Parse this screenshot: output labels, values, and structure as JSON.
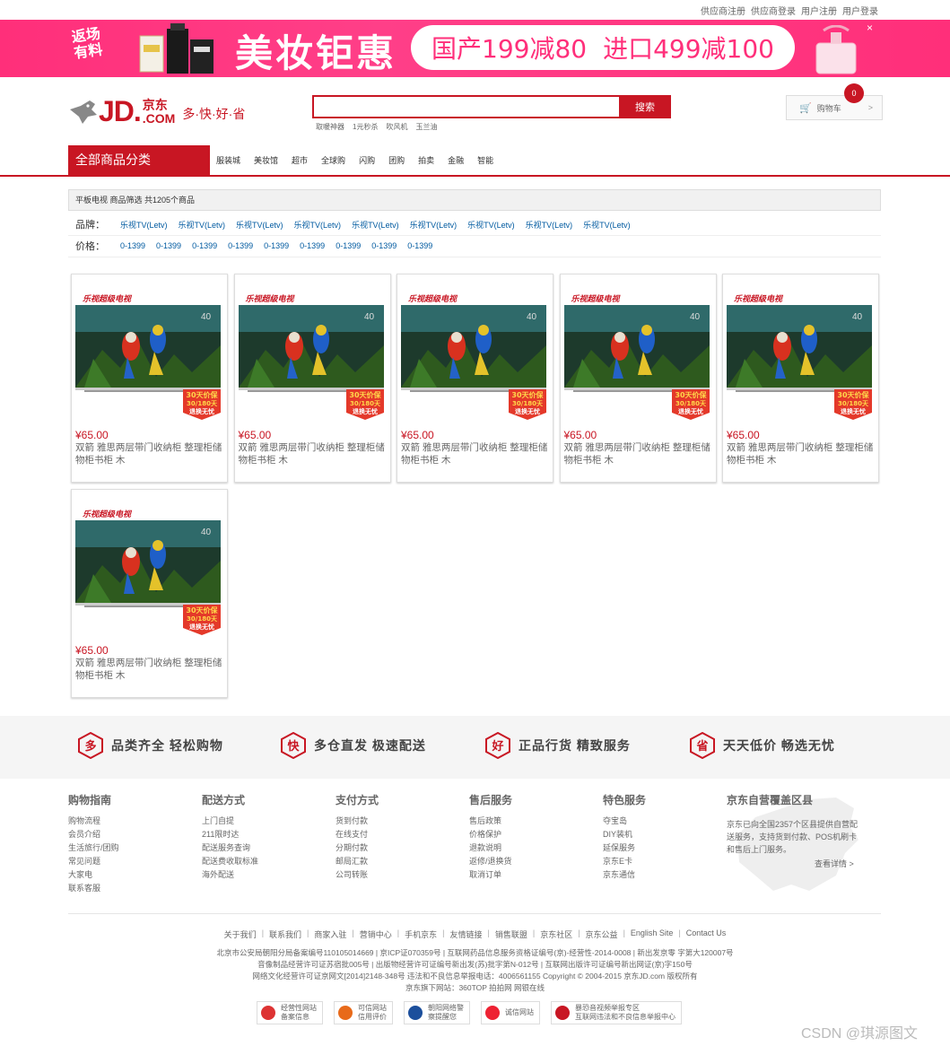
{
  "topbar": {
    "links": [
      "供应商注册",
      "供应商登录",
      "用户注册",
      "用户登录"
    ]
  },
  "banner": {
    "left_promo_line1": "返场",
    "left_promo_line2": "有料",
    "title": "美妆钜惠",
    "offer1": "国产199减80",
    "offer2": "进口499减100",
    "close": "×",
    "colors": {
      "bg": "#ff2f7a"
    }
  },
  "header": {
    "logo_text": "JD.",
    "logo_cn": "京东",
    "logo_com": ".COM",
    "slogan": "多·快·好·省",
    "search_button": "搜索",
    "hotwords": [
      "取暖神器",
      "1元秒杀",
      "吹风机",
      "玉兰油"
    ],
    "cart_label": "购物车",
    "cart_count": "0",
    "cart_arrow": ">"
  },
  "nav": {
    "all_categories": "全部商品分类",
    "items": [
      "服装城",
      "美妆馆",
      "超市",
      "全球购",
      "闪购",
      "团购",
      "拍卖",
      "金融",
      "智能"
    ]
  },
  "crumb": "平板电视 商品筛选 共1205个商品",
  "filters": {
    "brand_label": "品牌：",
    "brand_values": [
      "乐视TV(Letv)",
      "乐视TV(Letv)",
      "乐视TV(Letv)",
      "乐视TV(Letv)",
      "乐视TV(Letv)",
      "乐视TV(Letv)",
      "乐视TV(Letv)",
      "乐视TV(Letv)",
      "乐视TV(Letv)"
    ],
    "price_label": "价格：",
    "price_values": [
      "0-1399",
      "0-1399",
      "0-1399",
      "0-1399",
      "0-1399",
      "0-1399",
      "0-1399",
      "0-1399",
      "0-1399"
    ]
  },
  "products": [
    {
      "brand": "乐视超级电视",
      "badge": [
        "30天价保",
        "30/180天",
        "退换无忧"
      ],
      "price": "¥65.00",
      "title": "双箭 雅思两层带门收纳柜 整理柜储物柜书柜 木"
    },
    {
      "brand": "乐视超级电视",
      "badge": [
        "30天价保",
        "30/180天",
        "退换无忧"
      ],
      "price": "¥65.00",
      "title": "双箭 雅思两层带门收纳柜 整理柜储物柜书柜 木"
    },
    {
      "brand": "乐视超级电视",
      "badge": [
        "30天价保",
        "30/180天",
        "退换无忧"
      ],
      "price": "¥65.00",
      "title": "双箭 雅思两层带门收纳柜 整理柜储物柜书柜 木"
    },
    {
      "brand": "乐视超级电视",
      "badge": [
        "30天价保",
        "30/180天",
        "退换无忧"
      ],
      "price": "¥65.00",
      "title": "双箭 雅思两层带门收纳柜 整理柜储物柜书柜 木"
    },
    {
      "brand": "乐视超级电视",
      "badge": [
        "30天价保",
        "30/180天",
        "退换无忧"
      ],
      "price": "¥65.00",
      "title": "双箭 雅思两层带门收纳柜 整理柜储物柜书柜 木"
    },
    {
      "brand": "乐视超级电视",
      "badge": [
        "30天价保",
        "30/180天",
        "退换无忧"
      ],
      "price": "¥65.00",
      "title": "双箭 雅思两层带门收纳柜 整理柜储物柜书柜 木"
    }
  ],
  "services": [
    {
      "icon_char": "多",
      "text": "品类齐全 轻松购物"
    },
    {
      "icon_char": "快",
      "text": "多仓直发 极速配送"
    },
    {
      "icon_char": "好",
      "text": "正品行货 精致服务"
    },
    {
      "icon_char": "省",
      "text": "天天低价 畅选无忧"
    }
  ],
  "help": [
    {
      "title": "购物指南",
      "links": [
        "购物流程",
        "会员介绍",
        "生活旅行/团购",
        "常见问题",
        "大家电",
        "联系客服"
      ]
    },
    {
      "title": "配送方式",
      "links": [
        "上门自提",
        "211限时达",
        "配送服务查询",
        "配送费收取标准",
        "海外配送"
      ]
    },
    {
      "title": "支付方式",
      "links": [
        "货到付款",
        "在线支付",
        "分期付款",
        "邮局汇款",
        "公司转账"
      ]
    },
    {
      "title": "售后服务",
      "links": [
        "售后政策",
        "价格保护",
        "退款说明",
        "返修/退换货",
        "取消订单"
      ]
    },
    {
      "title": "特色服务",
      "links": [
        "夺宝岛",
        "DIY装机",
        "延保服务",
        "京东E卡",
        "京东通信"
      ]
    }
  ],
  "coverage": {
    "title": "京东自营覆盖区县",
    "text": "京东已向全国2357个区县提供自营配送服务，支持货到付款、POS机刷卡和售后上门服务。",
    "more": "查看详情 >"
  },
  "footer_links": [
    "关于我们",
    "联系我们",
    "商家入驻",
    "营销中心",
    "手机京东",
    "友情链接",
    "销售联盟",
    "京东社区",
    "京东公益",
    "English Site",
    "Contact Us"
  ],
  "copyright_lines": [
    "北京市公安局朝阳分局备案编号110105014669 | 京ICP证070359号 | 互联网药品信息服务资格证编号(京)-经营性-2014-0008 | 新出发京零 字第大120007号",
    "音像制品经营许可证苏宿批005号 | 出版物经营许可证编号新出发(苏)批字第N-012号 | 互联网出版许可证编号新出网证(京)字150号",
    "网络文化经营许可证京网文[2014]2148-348号 违法和不良信息举报电话：4006561155 Copyright © 2004-2015 京东JD.com 版权所有",
    "京东旗下网站：360TOP 拍拍网 网银在线"
  ],
  "certs": [
    {
      "line1": "经营性网站",
      "line2": "备案信息",
      "color": "#d33"
    },
    {
      "line1": "可信网站",
      "line2": "信用评价",
      "color": "#e86a1a"
    },
    {
      "line1": "朝阳网络警",
      "line2": "察提醒您",
      "color": "#1c4f9c"
    },
    {
      "line1": "诚信网站",
      "line2": "",
      "color": "#e23"
    },
    {
      "line1": "暴恐音视频举报专区",
      "line2": "互联网违法和不良信息举报中心",
      "color": "#c81623"
    }
  ],
  "watermark": "CSDN @琪源图文"
}
